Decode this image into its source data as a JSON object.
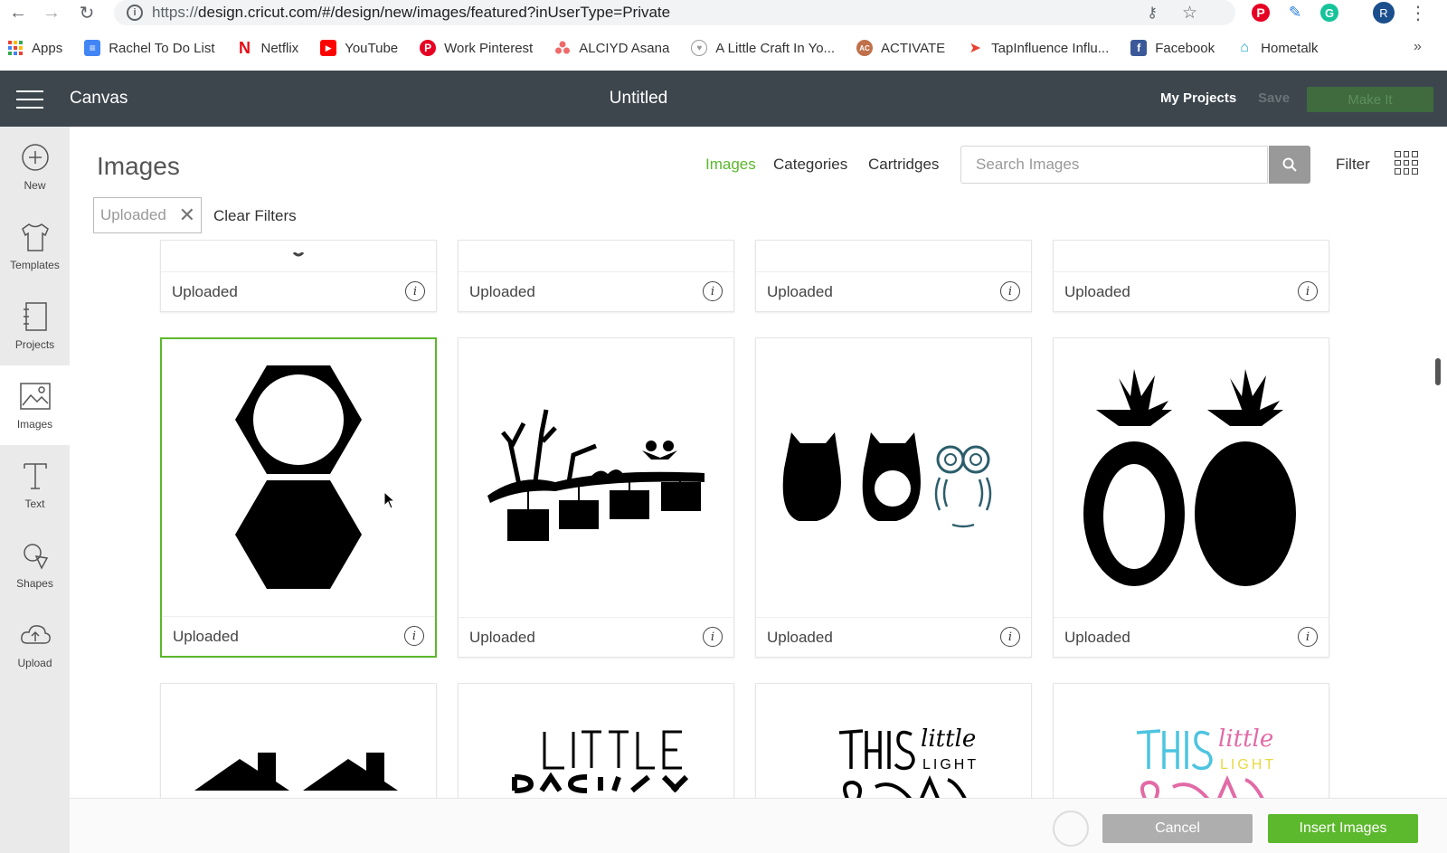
{
  "browser": {
    "url_scheme": "https://",
    "url_rest": "design.cricut.com/#/design/new/images/featured?inUserType=Private",
    "avatar_letter": "R",
    "bookmarks": [
      {
        "label": "Apps",
        "icon": "apps-grid-icon",
        "color": "#e94235"
      },
      {
        "label": "Rachel To Do List",
        "icon": "docs-icon",
        "color": "#4285f4"
      },
      {
        "label": "Netflix",
        "icon": "netflix-icon",
        "color": "#e50914"
      },
      {
        "label": "YouTube",
        "icon": "youtube-icon",
        "color": "#ff0000"
      },
      {
        "label": "Work Pinterest",
        "icon": "pinterest-icon",
        "color": "#e60023"
      },
      {
        "label": "ALCIYD Asana",
        "icon": "asana-icon",
        "color": "#f06a6a"
      },
      {
        "label": "A Little Craft In Yo...",
        "icon": "craft-icon",
        "color": "#999999"
      },
      {
        "label": "ACTIVATE",
        "icon": "activate-icon",
        "color": "#c0704a"
      },
      {
        "label": "TapInfluence Influ...",
        "icon": "tapinfluence-icon",
        "color": "#e8402f"
      },
      {
        "label": "Facebook",
        "icon": "facebook-icon",
        "color": "#3b5998"
      },
      {
        "label": "Hometalk",
        "icon": "hometalk-icon",
        "color": "#19a7ce"
      }
    ],
    "more": "»"
  },
  "header": {
    "app_name": "Canvas",
    "doc_title": "Untitled",
    "my_projects": "My Projects",
    "save": "Save",
    "make_it": "Make It"
  },
  "sidebar": {
    "items": [
      {
        "label": "New",
        "icon": "plus-circle-icon"
      },
      {
        "label": "Templates",
        "icon": "tshirt-icon"
      },
      {
        "label": "Projects",
        "icon": "projects-icon"
      },
      {
        "label": "Images",
        "icon": "image-icon"
      },
      {
        "label": "Text",
        "icon": "text-icon"
      },
      {
        "label": "Shapes",
        "icon": "shapes-icon"
      },
      {
        "label": "Upload",
        "icon": "cloud-upload-icon"
      }
    ],
    "active": "Images"
  },
  "main": {
    "title": "Images",
    "tabs": [
      {
        "label": "Images",
        "active": true
      },
      {
        "label": "Categories",
        "active": false
      },
      {
        "label": "Cartridges",
        "active": false
      }
    ],
    "search_placeholder": "Search Images",
    "filter_label": "Filter",
    "chip_label": "Uploaded",
    "clear_filters": "Clear Filters",
    "card_label": "Uploaded",
    "cards_row2": [
      "hexagon-frames",
      "tree-branch-birds",
      "owls-set",
      "pineapples"
    ],
    "cards_row3": [
      "house-roofs",
      "little-text",
      "this-little-light-black",
      "this-little-light-color"
    ]
  },
  "bottom": {
    "cancel": "Cancel",
    "insert": "Insert Images"
  },
  "colors": {
    "accent_green": "#5cb82c",
    "header_bg": "#3d464d"
  }
}
